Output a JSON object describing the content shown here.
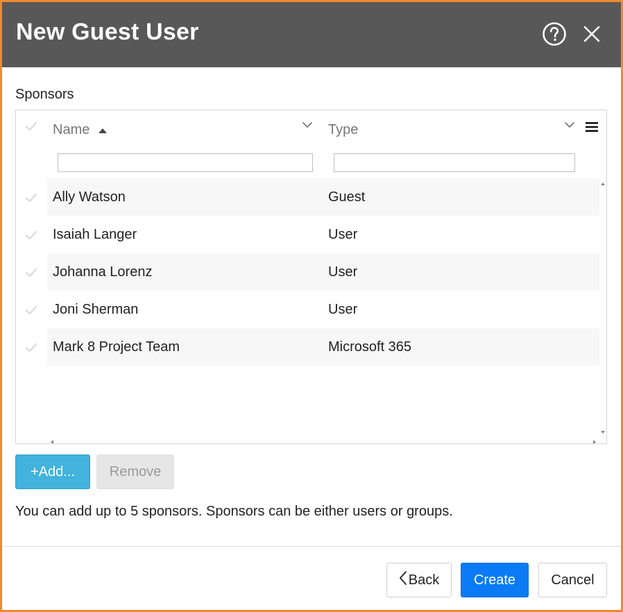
{
  "dialog": {
    "title": "New Guest User",
    "help_icon": "help-circle-icon",
    "close_icon": "close-icon"
  },
  "sponsors": {
    "label": "Sponsors",
    "columns": {
      "name": "Name",
      "type": "Type"
    },
    "sort": {
      "column": "Name",
      "direction": "ascending"
    },
    "filters": {
      "name_value": "",
      "type_value": ""
    },
    "rows": [
      {
        "name": "Ally Watson",
        "type": "Guest"
      },
      {
        "name": "Isaiah Langer",
        "type": "User"
      },
      {
        "name": "Johanna Lorenz",
        "type": "User"
      },
      {
        "name": "Joni Sherman",
        "type": "User"
      },
      {
        "name": "Mark 8 Project Team",
        "type": "Microsoft 365"
      }
    ]
  },
  "actions": {
    "add_label": "+Add...",
    "remove_label": "Remove"
  },
  "hint": "You can add up to 5 sponsors. Sponsors can be either users or groups.",
  "footer": {
    "back_label": "Back",
    "create_label": "Create",
    "cancel_label": "Cancel"
  },
  "colors": {
    "titlebar": "#585858",
    "border": "#f08a2c",
    "add_button": "#41b3dc",
    "create_button": "#0a7bf5"
  }
}
